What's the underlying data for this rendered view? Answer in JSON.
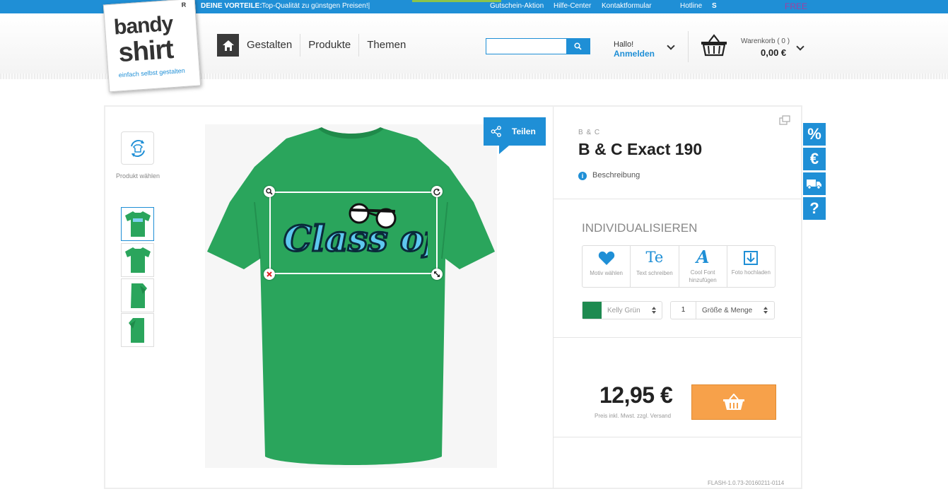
{
  "topbar": {
    "vorteile_label": "DEINE VORTEILE:",
    "vorteile_text": "Top-Qualität zu günstgen Preisen!|",
    "links": [
      "Gutschein-Aktion",
      "Hilfe-Center",
      "Kontaktformular",
      "Hotline"
    ],
    "extra": "S",
    "free": "FREE"
  },
  "logo": {
    "line1": "bandy",
    "line2": "shirt",
    "tagline": "einfach selbst gestalten",
    "reg": "R"
  },
  "nav": {
    "items": [
      "Gestalten",
      "Produkte",
      "Themen"
    ]
  },
  "search": {
    "placeholder": ""
  },
  "account": {
    "greeting": "Hallo!",
    "login": "Anmelden"
  },
  "cart": {
    "label": "Warenkorb ( 0 )",
    "total": "0,00 €"
  },
  "designer": {
    "produkt_waehlen": "Produkt wählen",
    "share_label": "Teilen",
    "design_text": "Class of"
  },
  "product": {
    "brand": "B & C",
    "title": "B & C Exact 190",
    "description_link": "Beschreibung",
    "individualize": "INDIVIDUALISIEREN",
    "tools": [
      {
        "icon": "heart-icon",
        "label": "Motiv wählen"
      },
      {
        "icon": "text-icon",
        "label": "Text schreiben",
        "glyph": "Te"
      },
      {
        "icon": "font-icon",
        "label": "Cool Font hinzufügen",
        "glyph": "A"
      },
      {
        "icon": "upload-icon",
        "label": "Foto hochladen"
      }
    ],
    "color": {
      "name": "Kelly Grün",
      "hex": "#1e8a50"
    },
    "quantity": "1",
    "size_label": "Größe & Menge",
    "price": "12,95 €",
    "price_note": "Preis inkl. Mwst. zzgl. Versand"
  },
  "version": "FLASH-1.0.73-20160211-0114",
  "side_icons": [
    "%",
    "€",
    "truck-icon",
    "?"
  ],
  "colors": {
    "accent": "#1f8fd6",
    "shirt": "#2aa55c",
    "cart_button": "#f7a14a"
  }
}
